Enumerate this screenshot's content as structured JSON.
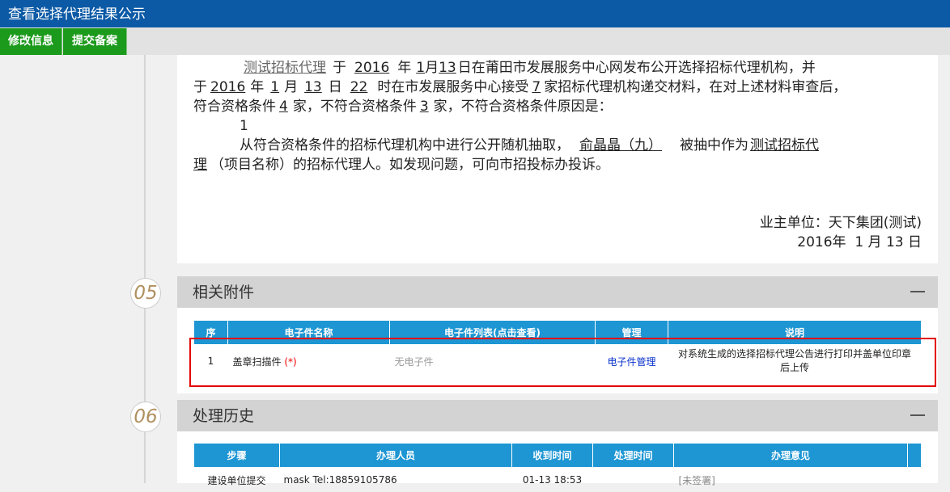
{
  "window": {
    "title": "查看选择代理结果公示"
  },
  "toolbar": {
    "edit_label": "修改信息",
    "submit_label": "提交备案"
  },
  "notice": {
    "line1": [
      "测试招标代理",
      "于",
      "2016",
      "年",
      "1",
      "月",
      "13",
      "日在莆田市发展服务中心网发布公开选择招标代理机构，并"
    ],
    "line2": [
      "于",
      "2016",
      "年",
      "1",
      "月",
      "13",
      "日",
      "22",
      "时在市发展服务中心接受",
      "7",
      "家招标代理机构递交材料，在对上述材料审查后，"
    ],
    "line3": [
      "符合资格条件",
      "4",
      "家，不符合资格条件",
      "3",
      "家，不符合资格条件原因是："
    ],
    "line4": "1",
    "line5": [
      "从符合资格条件的招标代理机构中进行公开随机抽取，",
      "俞晶晶（九）",
      "被抽中作为",
      "测试招标代"
    ],
    "line6": [
      "理",
      "（项目名称）的招标代理人。如发现问题，可向市招投标办投诉。"
    ],
    "owner": "业主单位：天下集团(测试)",
    "date": "2016年  1 月 13 日"
  },
  "attachments": {
    "number": "05",
    "title": "相关附件",
    "columns": [
      "序",
      "电子件名称",
      "电子件列表(点击查看)",
      "管理",
      "说明"
    ],
    "rows": [
      {
        "index": "1",
        "name": "盖章扫描件",
        "required_mark": "(*)",
        "files": "无电子件",
        "manage": "电子件管理",
        "desc": "对系统生成的选择招标代理公告进行打印并盖单位印章后上传"
      }
    ]
  },
  "history": {
    "number": "06",
    "title": "处理历史",
    "columns": [
      "步骤",
      "办理人员",
      "收到时间",
      "处理时间",
      "办理意见"
    ],
    "rows": [
      {
        "step": "建设单位提交",
        "person": "mask Tel:18859105786",
        "received": "01-13 18:53",
        "processed": "",
        "opinion": "[未签署]"
      }
    ]
  },
  "colors": {
    "title_bar": "#0c5aa6",
    "button": "#1c9a1c",
    "table_header": "#1d96d3",
    "highlight": "#e30000"
  }
}
